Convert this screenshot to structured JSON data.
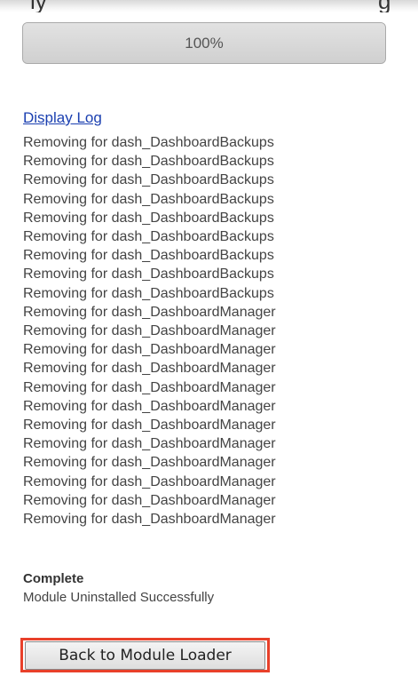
{
  "header": {
    "partial_text_left": "ly",
    "partial_text_right": "g"
  },
  "progress": {
    "label": "100%",
    "value": 1.0
  },
  "log": {
    "link_label": "Display Log",
    "lines": [
      "Removing for dash_DashboardBackups",
      "Removing for dash_DashboardBackups",
      "Removing for dash_DashboardBackups",
      "Removing for dash_DashboardBackups",
      "Removing for dash_DashboardBackups",
      "Removing for dash_DashboardBackups",
      "Removing for dash_DashboardBackups",
      "Removing for dash_DashboardBackups",
      "Removing for dash_DashboardBackups",
      "Removing for dash_DashboardManager",
      "Removing for dash_DashboardManager",
      "Removing for dash_DashboardManager",
      "Removing for dash_DashboardManager",
      "Removing for dash_DashboardManager",
      "Removing for dash_DashboardManager",
      "Removing for dash_DashboardManager",
      "Removing for dash_DashboardManager",
      "Removing for dash_DashboardManager",
      "Removing for dash_DashboardManager",
      "Removing for dash_DashboardManager",
      "Removing for dash_DashboardManager"
    ]
  },
  "status": {
    "title": "Complete",
    "message": "Module Uninstalled Successfully"
  },
  "actions": {
    "back_label": "Back to Module Loader",
    "highlight_color": "#e8402a"
  }
}
